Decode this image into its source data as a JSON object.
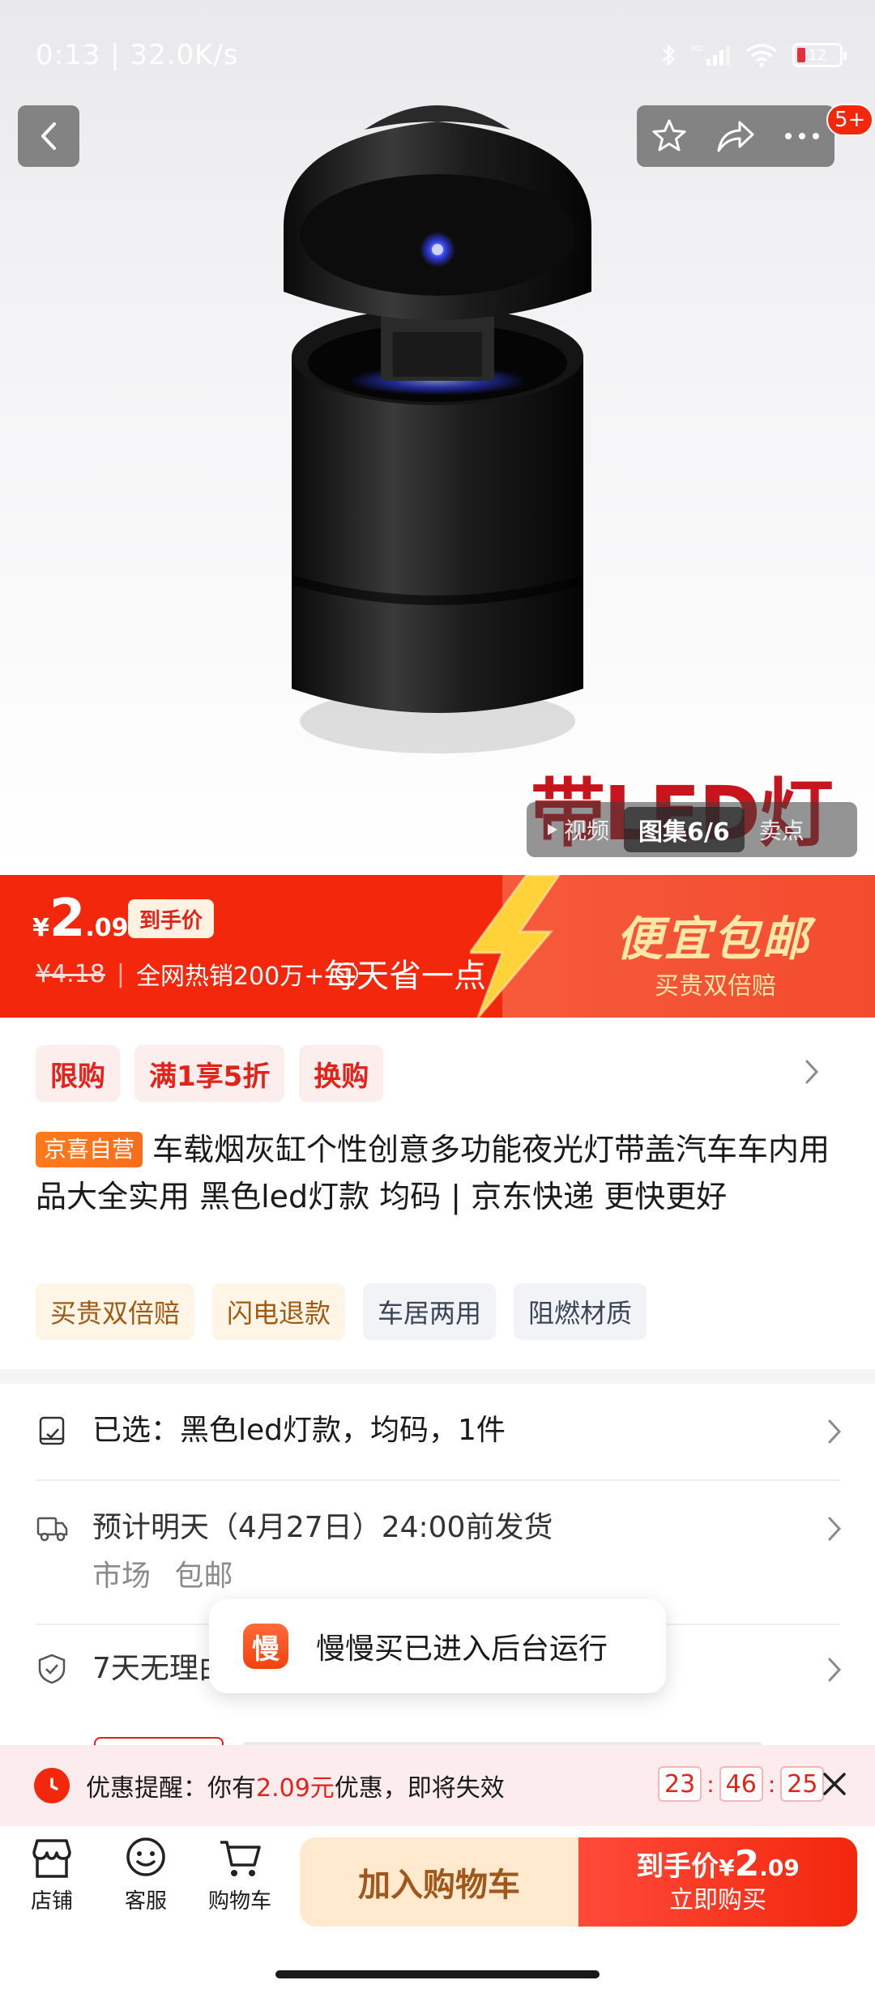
{
  "status_bar": {
    "time_speed": "0:13 | 32.0K/s",
    "battery": "12"
  },
  "header": {
    "message_badge": "5+"
  },
  "hero": {
    "overlay_text": "带LED灯"
  },
  "gallery": {
    "tabs": [
      "视频",
      "图集6/6",
      "卖点"
    ]
  },
  "price": {
    "currency": "¥",
    "integer": "2",
    "decimal": ".09",
    "final_tag": "到手价",
    "original": "¥4.18",
    "separator": "|",
    "sales": "全网热销200万+",
    "slogan": "每天省一点",
    "promo_title": "便宜包邮",
    "promo_sub": "买贵双倍赔"
  },
  "promos": [
    "限购",
    "满1享5折",
    "换购"
  ],
  "product": {
    "self_badge": "京喜自营",
    "title": "车载烟灰缸个性创意多功能夜光灯带盖汽车车内用品大全实用 黑色led灯款 均码 | 京东快递 更快更好"
  },
  "features": [
    {
      "label": "买贵双倍赔",
      "style": "warm"
    },
    {
      "label": "闪电退款",
      "style": "warm"
    },
    {
      "label": "车居两用",
      "style": "cool"
    },
    {
      "label": "阻燃材质",
      "style": "cool"
    }
  ],
  "selected": {
    "text": "已选：黑色led灯款，均码，1件"
  },
  "shipping": {
    "text": "预计明天（4月27日）24:00前发货",
    "tags": [
      "市场",
      "包邮"
    ]
  },
  "returns": {
    "text": "7天无理由退货"
  },
  "toast": {
    "icon_char": "慢",
    "text": "慢慢买已进入后台运行"
  },
  "reminder": {
    "prefix": "优惠提醒：你有",
    "amount": "2.09元",
    "suffix": "优惠，即将失效",
    "countdown": [
      "23",
      "46",
      "25"
    ],
    "sep": ":"
  },
  "bottom_nav": {
    "store": "店铺",
    "service": "客服",
    "cart": "购物车"
  },
  "actions": {
    "add_to_cart": "加入购物车",
    "buy_top_label": "到手价",
    "buy_top_currency": "¥",
    "buy_top_int": "2",
    "buy_top_dec": ".09",
    "buy_bottom": "立即购买"
  },
  "colors": {
    "brand_red": "#f2270c",
    "promo_gold": "#ffe7a8",
    "self_badge_orange": "#ff7a1a"
  }
}
